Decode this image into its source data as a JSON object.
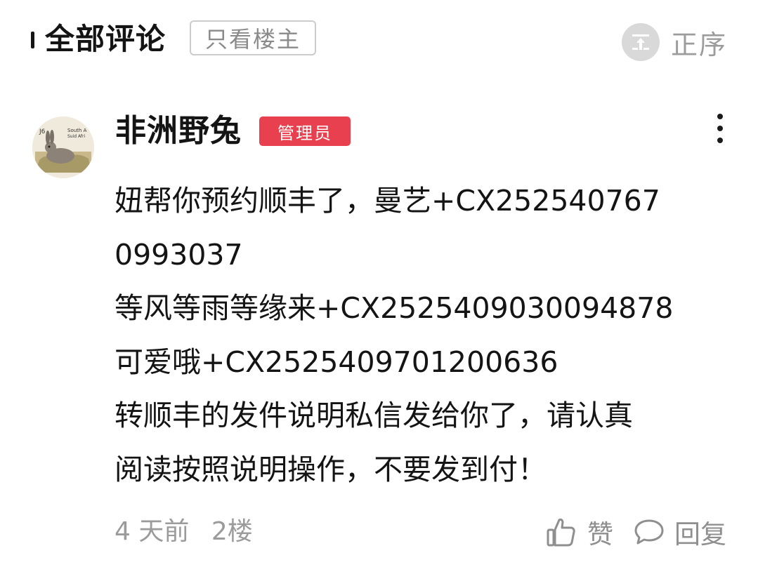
{
  "header": {
    "title": "全部评论",
    "filter_label": "只看楼主",
    "sort_label": "正序"
  },
  "comment": {
    "username": "非洲野兔",
    "badge": "管理员",
    "avatar_icon": "rabbit-stamp-avatar",
    "avatar_stamp_text": "South Africa",
    "lines": [
      "妞帮你预约顺丰了，曼艺+CX252540767",
      "0993037",
      "等风等雨等缘来+CX2525409030094878",
      "可爱哦+CX2525409701200636",
      "转顺丰的发件说明私信发给你了，请认真",
      "阅读按照说明操作，不要发到付！"
    ],
    "time": "4 天前",
    "floor": "2楼",
    "like_label": "赞",
    "reply_label": "回复"
  },
  "colors": {
    "badge": "#e8404e",
    "muted_text": "#9b9b9b",
    "sort_icon_bg": "#d9d9d9"
  }
}
